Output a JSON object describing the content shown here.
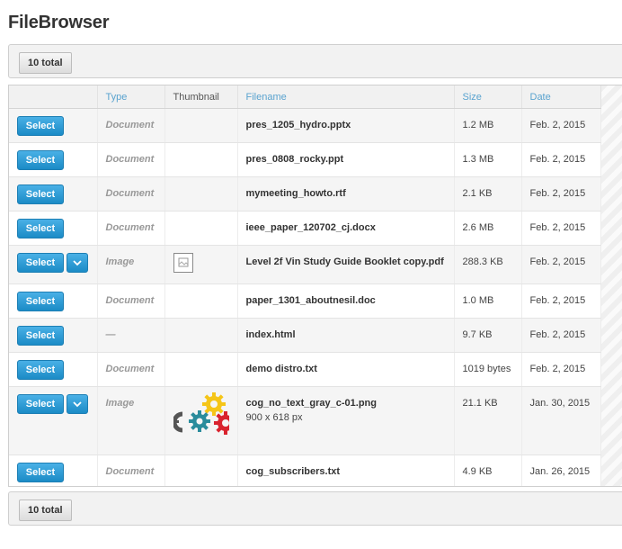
{
  "app": {
    "title": "FileBrowser"
  },
  "summary": {
    "total_label": "10 total"
  },
  "columns": {
    "select": "",
    "type": "Type",
    "thumbnail": "Thumbnail",
    "filename": "Filename",
    "size": "Size",
    "date": "Date"
  },
  "select_label": "Select",
  "rows": [
    {
      "type": "Document",
      "filename": "pres_1205_hydro.pptx",
      "size": "1.2 MB",
      "date": "Feb. 2, 2015"
    },
    {
      "type": "Document",
      "filename": "pres_0808_rocky.ppt",
      "size": "1.3 MB",
      "date": "Feb. 2, 2015"
    },
    {
      "type": "Document",
      "filename": "mymeeting_howto.rtf",
      "size": "2.1 KB",
      "date": "Feb. 2, 2015"
    },
    {
      "type": "Document",
      "filename": "ieee_paper_120702_cj.docx",
      "size": "2.6 MB",
      "date": "Feb. 2, 2015"
    },
    {
      "type": "Image",
      "filename": "Level 2f Vin Study Guide Booklet copy.pdf",
      "size": "288.3 KB",
      "date": "Feb. 2, 2015",
      "thumbnail": "broken-image-icon"
    },
    {
      "type": "Document",
      "filename": "paper_1301_aboutnesil.doc",
      "size": "1.0 MB",
      "date": "Feb. 2, 2015"
    },
    {
      "type": "—",
      "filename": "index.html",
      "size": "9.7 KB",
      "date": "Feb. 2, 2015"
    },
    {
      "type": "Document",
      "filename": "demo distro.txt",
      "size": "1019 bytes",
      "date": "Feb. 2, 2015"
    },
    {
      "type": "Image",
      "filename": "cog_no_text_gray_c-01.png",
      "dimensions": "900 x 618 px",
      "size": "21.1 KB",
      "date": "Jan. 30, 2015",
      "thumbnail": "cog-logo-thumbnail"
    },
    {
      "type": "Document",
      "filename": "cog_subscribers.txt",
      "size": "4.9 KB",
      "date": "Jan. 26, 2015"
    }
  ],
  "colors": {
    "accent": "#1b8bc6",
    "link": "#5aa3cf",
    "cog_yellow": "#f5c518",
    "cog_teal": "#2a8c9c",
    "cog_red": "#d9232e",
    "cog_gray": "#555555"
  }
}
